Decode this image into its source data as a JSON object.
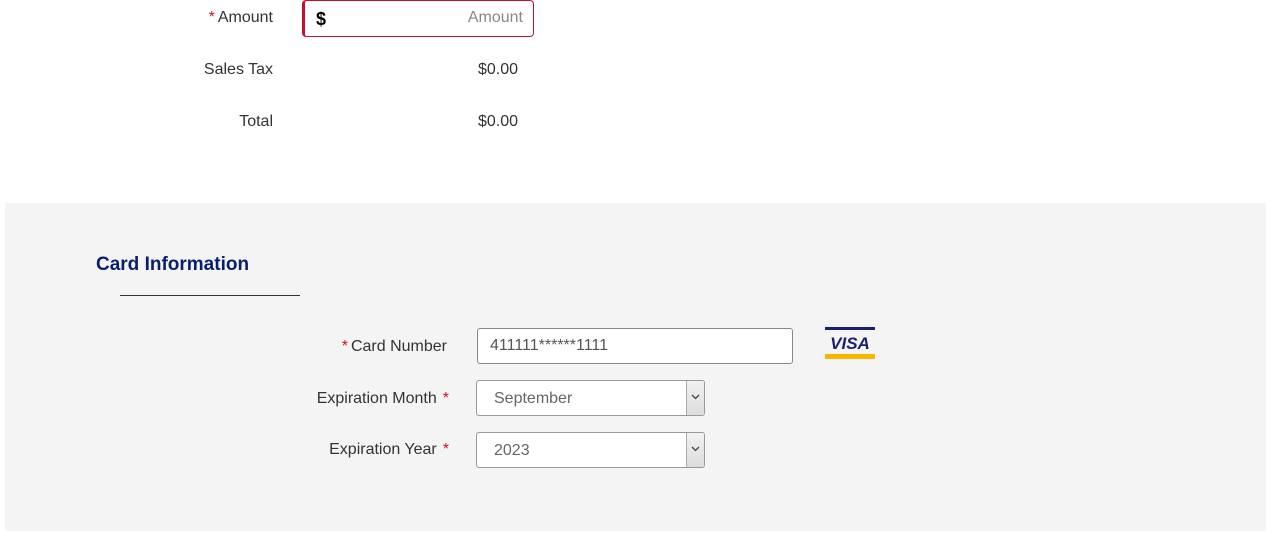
{
  "amount": {
    "required_marker": "*",
    "label": "Amount",
    "currency_symbol": "$",
    "placeholder": "Amount",
    "value": ""
  },
  "sales_tax": {
    "label": "Sales Tax",
    "value": "$0.00"
  },
  "total": {
    "label": "Total",
    "value": "$0.00"
  },
  "card": {
    "title": "Card Information",
    "number": {
      "required_marker": "*",
      "label": "Card Number",
      "value": "411111******1111",
      "brand_icon": "visa-icon",
      "brand_text": "VISA"
    },
    "exp_month": {
      "label": "Expiration Month",
      "required_marker": "*",
      "selected": "September"
    },
    "exp_year": {
      "label": "Expiration Year",
      "required_marker": "*",
      "selected": "2023"
    }
  },
  "colors": {
    "required": "#c8102e",
    "title": "#0a1f6b",
    "panel_bg": "#f4f4f4",
    "visa_blue": "#1a1f71",
    "visa_gold": "#f7b600"
  }
}
